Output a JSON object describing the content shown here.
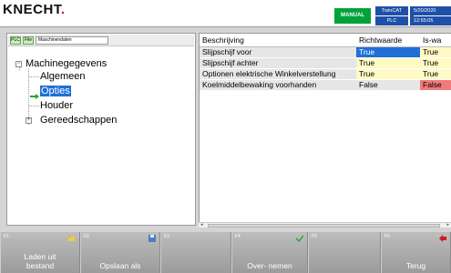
{
  "header": {
    "logo_text": "KNECHT",
    "mode_badge": "MANUAL",
    "twincat_top": "TwinCAT",
    "twincat_bottom": "PLC",
    "date": "5/20/2020",
    "time": "12:55:05",
    "colors": {
      "mode_badge": "#00a23a",
      "status_blue": "#1f50a8",
      "logo_accent": "#d21b1b"
    }
  },
  "tree_panel": {
    "toolbar": {
      "chip_plc": "PLC",
      "chip_file": "File",
      "path_field": "Maschinendaten"
    },
    "root_label": "Machinegegevens",
    "items": [
      {
        "label": "Algemeen",
        "selected": false
      },
      {
        "label": "Opties",
        "selected": true
      },
      {
        "label": "Houder",
        "selected": false
      },
      {
        "label": "Gereedschappen",
        "selected": false,
        "expandable": true
      }
    ]
  },
  "table": {
    "columns": [
      "Beschrijving",
      "Richtwaarde",
      "Is-wa"
    ],
    "rows": [
      {
        "desc": "Slijpschijf voor",
        "target": "True",
        "actual": "True"
      },
      {
        "desc": "Slijpschijf achter",
        "target": "True",
        "actual": "True"
      },
      {
        "desc": "Optionen elektrische Winkelverstellung",
        "target": "True",
        "actual": "True"
      },
      {
        "desc": "Koelmiddelbewaking voorhanden",
        "target": "False",
        "actual": "False"
      }
    ]
  },
  "function_keys": [
    {
      "key": "F1",
      "label_line1": "Laden uit",
      "label_line2": "bestand",
      "icon": "folder-icon"
    },
    {
      "key": "F2",
      "label_line1": "Opslaan als",
      "label_line2": "",
      "icon": "save-icon"
    },
    {
      "key": "F3",
      "label_line1": "",
      "label_line2": "",
      "icon": ""
    },
    {
      "key": "F4",
      "label_line1": "Over- nemen",
      "label_line2": "",
      "icon": "checkmark-icon"
    },
    {
      "key": "F5",
      "label_line1": "",
      "label_line2": "",
      "icon": ""
    },
    {
      "key": "F6",
      "label_line1": "Terug",
      "label_line2": "",
      "icon": "back-arrow-icon"
    }
  ]
}
